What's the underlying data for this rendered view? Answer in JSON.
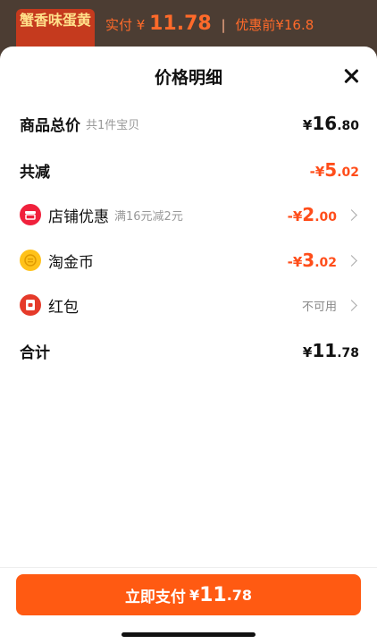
{
  "background": {
    "thumb_text": "蟹香味蛋黄",
    "paid_label": "实付",
    "paid_yen": "¥",
    "paid_amount": "11.78",
    "before_label": "优惠前¥16.8"
  },
  "sheet": {
    "title": "价格明细"
  },
  "rows": {
    "total": {
      "label": "商品总价",
      "sub": "共1件宝贝",
      "yen": "¥",
      "int": "16",
      "dec": ".80"
    },
    "reduce": {
      "label": "共减",
      "yen": "-¥",
      "int": "5",
      "dec": ".02"
    },
    "shop": {
      "label": "店铺优惠",
      "sub": "满16元减2元",
      "yen": "-¥",
      "int": "2",
      "dec": ".00"
    },
    "coin": {
      "label": "淘金币",
      "yen": "-¥",
      "int": "3",
      "dec": ".02"
    },
    "redpack": {
      "label": "红包",
      "status": "不可用"
    },
    "sum": {
      "label": "合计",
      "yen": "¥",
      "int": "11",
      "dec": ".78"
    }
  },
  "pay_button": {
    "label": "立即支付",
    "yen": "¥",
    "int": "11",
    "dec": ".78"
  },
  "colors": {
    "accent": "#ff5a12",
    "discount": "#ff4d1a"
  },
  "icons": {
    "shop": "store-icon",
    "coin": "gold-coin-icon",
    "redpack": "red-packet-icon",
    "close": "close-icon"
  }
}
